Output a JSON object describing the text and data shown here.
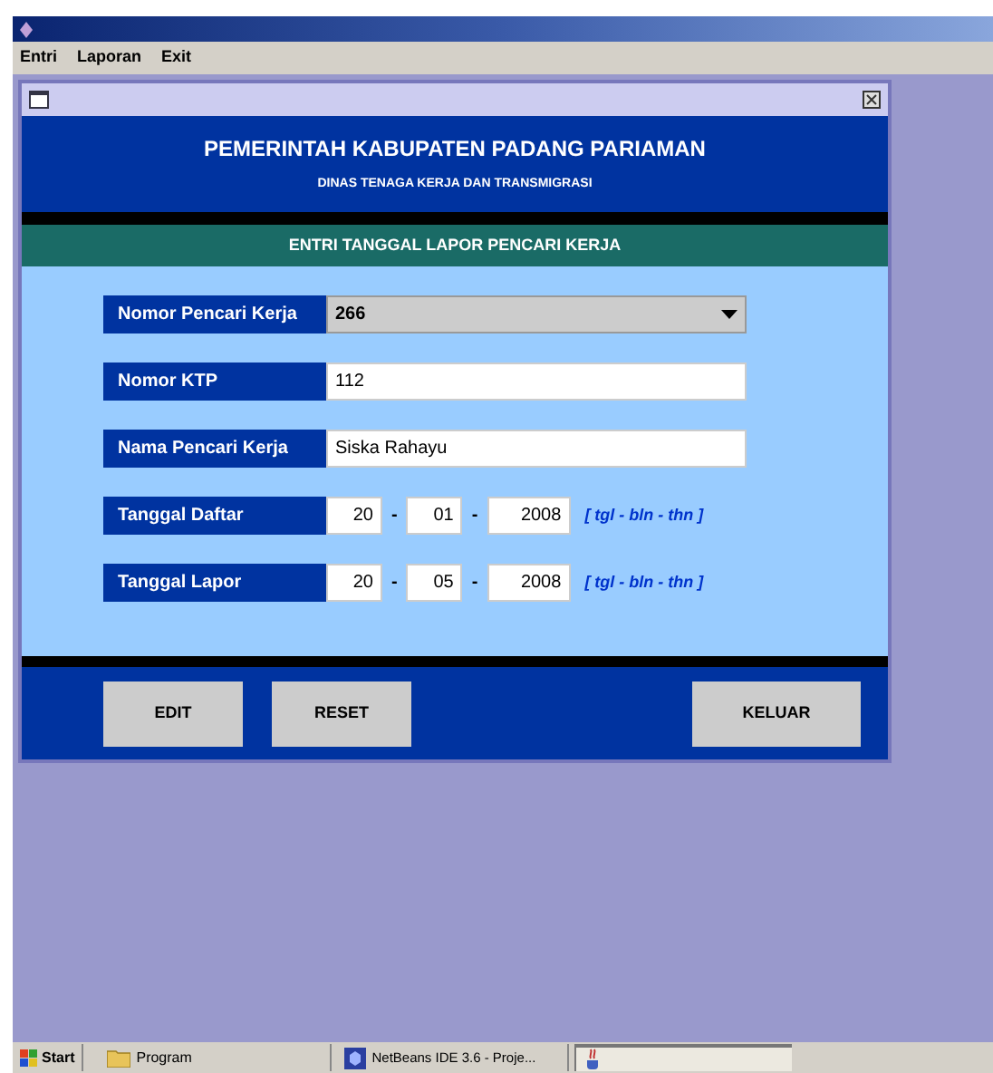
{
  "menu": [
    "Entri",
    "Laporan",
    "Exit"
  ],
  "form": {
    "title": "PEMERINTAH KABUPATEN PADANG PARIAMAN",
    "subtitle": "DINAS TENAGA KERJA DAN TRANSMIGRASI",
    "section": "ENTRI TANGGAL LAPOR PENCARI KERJA",
    "fields": [
      {
        "kind": "select",
        "label": "Nomor Pencari Kerja",
        "value": "266"
      },
      {
        "kind": "text",
        "label": "Nomor KTP",
        "value": "112"
      },
      {
        "kind": "text",
        "label": "Nama Pencari Kerja",
        "value": "Siska Rahayu"
      },
      {
        "kind": "date",
        "label": "Tanggal Daftar",
        "day": "20",
        "month": "01",
        "year": "2008",
        "separator": "-",
        "hint": "[ tgl - bln - thn ]"
      },
      {
        "kind": "date",
        "label": "Tanggal Lapor",
        "day": "20",
        "month": "05",
        "year": "2008",
        "separator": "-",
        "hint": "[ tgl - bln - thn ]"
      }
    ],
    "buttons": [
      "EDIT",
      "RESET",
      "KELUAR"
    ]
  },
  "taskbar": {
    "start": "Start",
    "items": [
      {
        "kind": "folder",
        "label": "Program",
        "selected": false
      },
      {
        "kind": "netbeans",
        "label": "NetBeans IDE 3.6 - Proje...",
        "selected": false
      },
      {
        "kind": "java",
        "selected": true
      }
    ]
  }
}
